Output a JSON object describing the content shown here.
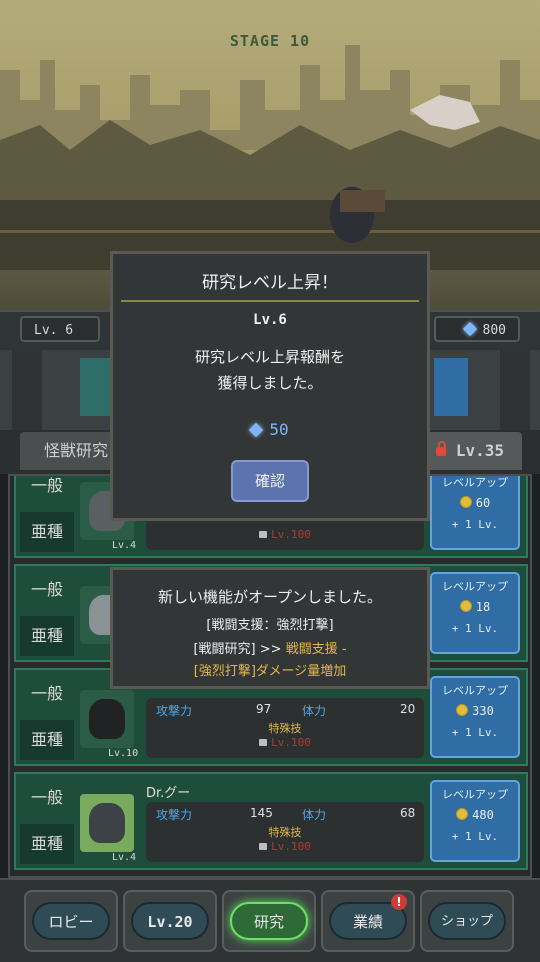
{
  "stage": "STAGE 10",
  "hud": {
    "level": "Lv. 6",
    "gems": "800"
  },
  "tabs": {
    "left": "怪獣研究",
    "right": "Lv.35"
  },
  "rows": [
    {
      "grade": "一般",
      "subtype": "亜種",
      "level": "Lv.4",
      "lock_level": "Lv.100",
      "up_label": "レベルアップ",
      "cost": "60",
      "plus": "+ 1 Lv."
    },
    {
      "grade": "一般",
      "subtype": "亜種",
      "level": "",
      "up_label": "レベルアップ",
      "cost": "18",
      "plus": "+ 1 Lv."
    },
    {
      "grade": "一般",
      "subtype": "亜種",
      "level": "Lv.10",
      "name": "",
      "atk_label": "攻撃力",
      "atk": "97",
      "hp_label": "体力",
      "hp": "20",
      "special": "特殊技",
      "lock_level": "Lv.100",
      "up_label": "レベルアップ",
      "cost": "330",
      "plus": "+ 1 Lv."
    },
    {
      "grade": "一般",
      "subtype": "亜種",
      "level": "Lv.4",
      "name": "Dr.グー",
      "atk_label": "攻撃力",
      "atk": "145",
      "hp_label": "体力",
      "hp": "68",
      "special": "特殊技",
      "lock_level": "Lv.100",
      "up_label": "レベルアップ",
      "cost": "480",
      "plus": "+ 1 Lv."
    }
  ],
  "nav": {
    "lobby": "ロビー",
    "level": "Lv.20",
    "research": "研究",
    "achievements": "業績",
    "shop": "ショップ",
    "badge": "!"
  },
  "dialog": {
    "title": "研究レベル上昇！",
    "level": "Lv.6",
    "message1": "研究レベル上昇報酬を",
    "message2": "獲得しました。",
    "reward": "50",
    "confirm": "確認"
  },
  "toast": {
    "line1": "新しい機能がオープンしました。",
    "line2": "[戦闘支援：強烈打撃]",
    "line3a": "[戦闘研究] >> ",
    "line3b": "戦闘支援 -",
    "line4": "[強烈打撃]ダメージ量増加"
  },
  "colors": {
    "accent_green": "#5ce25b",
    "button_blue": "#2f6da4",
    "gem_blue": "#7fb4ff",
    "gold": "#e2b84a"
  }
}
